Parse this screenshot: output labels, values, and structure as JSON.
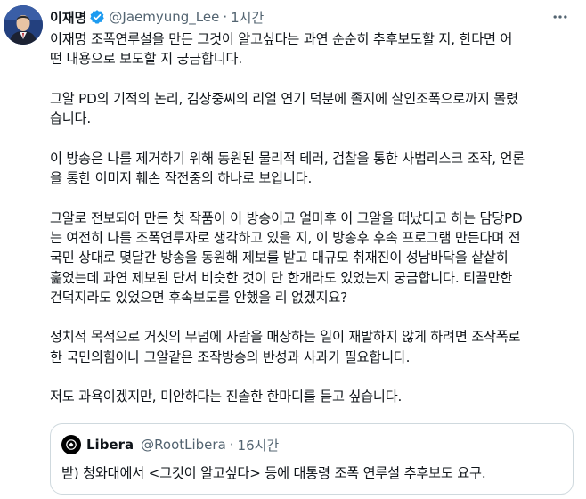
{
  "author": {
    "display_name": "이재명",
    "handle": "@Jaemyung_Lee",
    "separator": "·",
    "timestamp": "1시간",
    "verified_icon": "verified-badge-icon",
    "verified_color": "#1d9bf0"
  },
  "more_icon": "more-horizontal-icon",
  "body": {
    "paragraphs": [
      {
        "lines": [
          "이재명 조폭연루설을 만든 그것이 알고싶다는 과연 순순히 추후보도할 지, 한다면 어",
          "떤 내용으로 보도할 지 궁금합니다."
        ]
      },
      {
        "lines": [
          "그알 PD의 기적의 논리, 김상중씨의 리얼 연기 덕분에 졸지에 살인조폭으로까지 몰렸",
          "습니다."
        ]
      },
      {
        "lines": [
          "이 방송은 나를 제거하기 위해 동원된 물리적 테러, 검찰을 통한 사법리스크 조작, 언론",
          "을 통한 이미지 훼손 작전중의 하나로 보입니다."
        ]
      },
      {
        "lines": [
          "그알로 전보되어 만든 첫 작품이 이 방송이고 얼마후 이 그알을 떠났다고 하는 담당PD",
          "는 여전히 나를 조폭연루자로 생각하고 있을 지, 이 방송후 후속 프로그램 만든다며 전",
          "국민 상대로 몇달간 방송을 동원해 제보를 받고 대규모 취재진이 성남바닥을 샅샅히",
          "훑었는데 과연 제보된 단서 비슷한 것이 단 한개라도 있었는지 궁금합니다. 티끌만한",
          "건덕지라도 있었으면 후속보도를 안했을 리 없겠지요?"
        ]
      },
      {
        "lines": [
          "정치적 목적으로 거짓의 무덤에 사람을 매장하는 일이 재발하지 않게 하려면 조작폭로",
          "한 국민의힘이나 그알같은 조작방송의 반성과 사과가 필요합니다."
        ]
      },
      {
        "lines": [
          "저도 과욕이겠지만, 미안하다는 진솔한 한마디를 듣고 싶습니다."
        ]
      }
    ]
  },
  "quoted_tweet": {
    "avatar_icon": "libera-logo-icon",
    "display_name": "Libera",
    "handle": "@RootLibera",
    "separator": "·",
    "timestamp": "16시간",
    "text": "받) 청와대에서 <그것이 알고싶다> 등에 대통령 조폭 연루설 추후보도 요구."
  }
}
